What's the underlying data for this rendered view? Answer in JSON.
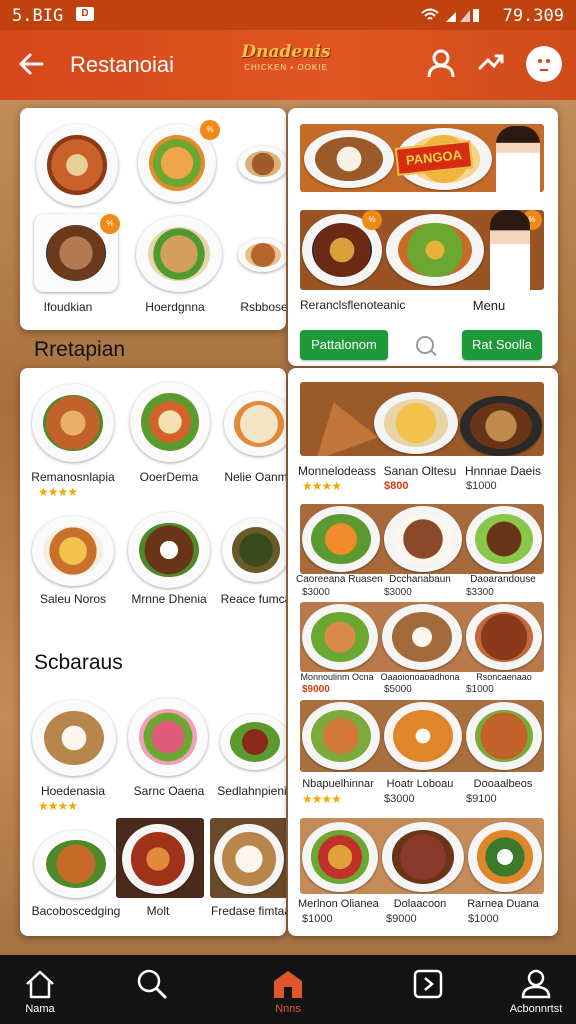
{
  "status_bar": {
    "left": "5.BIG",
    "sim": "D",
    "time": "79.309"
  },
  "app_bar": {
    "back_icon": "arrow-left-icon",
    "title": "Restanoiai",
    "logo_main": "Dnadenis",
    "logo_sub": "CHICKEN ▪ OOKIE"
  },
  "colors": {
    "accent": "#d6461a",
    "green": "#1f9a3b",
    "star": "#f2a900"
  },
  "top_left": {
    "labels": [
      "Ifoudkian",
      "Hoerdgnna",
      "Rsbbose"
    ]
  },
  "top_right": {
    "badge": "PANGOA",
    "caption": "Reranclsflenoteanic",
    "menu": "Menu",
    "left_button": "Pattalonom",
    "right_button": "Rat Soolla"
  },
  "sections": {
    "first": "Rretapian",
    "second": "Scbaraus"
  },
  "left_grid_1": [
    {
      "name": "Remanosnlapia",
      "stars": "★★★★"
    },
    {
      "name": "OoerDema",
      "stars": ""
    },
    {
      "name": "Nelie Oanm",
      "stars": ""
    },
    {
      "name": "Saleu Noros",
      "stars": ""
    },
    {
      "name": "Mrnne Dhenia",
      "stars": ""
    },
    {
      "name": "Reace fumca",
      "stars": ""
    }
  ],
  "left_grid_2": [
    {
      "name": "Hoedenasia",
      "stars": "★★★★"
    },
    {
      "name": "Sarnc Oaena",
      "stars": ""
    },
    {
      "name": "Sedlahnpienic",
      "stars": ""
    },
    {
      "name": "Bacoboscedging",
      "stars": ""
    },
    {
      "name": "Molt",
      "stars": ""
    },
    {
      "name": "Fredase fimtaa",
      "stars": ""
    }
  ],
  "right_rows": [
    {
      "items": [
        {
          "name": "Monnelodeass",
          "price": "",
          "stars": "★★★★",
          "red": false
        },
        {
          "name": "Sanan Oltesu",
          "price": "$800",
          "stars": "",
          "red": true
        },
        {
          "name": "Hnnnae Daeis",
          "price": "$1000",
          "stars": "",
          "red": false
        }
      ]
    },
    {
      "items": [
        {
          "name": "Caoreeana Ruasen",
          "price": "$3000",
          "stars": "",
          "red": false
        },
        {
          "name": "Dcchanabaun",
          "price": "$3000",
          "stars": "",
          "red": false
        },
        {
          "name": "Daoarandouse",
          "price": "$3300",
          "stars": "",
          "red": false
        }
      ]
    },
    {
      "items": [
        {
          "name": "Monnoulinm Ocna",
          "price": "$9000",
          "stars": "",
          "red": true
        },
        {
          "name": "Oaaoionoaoadhona",
          "price": "$5000",
          "stars": "",
          "red": false
        },
        {
          "name": "Rsoncaenaao",
          "price": "$1000",
          "stars": "",
          "red": false
        }
      ]
    },
    {
      "items": [
        {
          "name": "Nbapuelhinnar",
          "price": "",
          "stars": "★★★★",
          "red": false
        },
        {
          "name": "Hoatr Loboau",
          "price": "$3000",
          "stars": "",
          "red": false
        },
        {
          "name": "Dooaalbeos",
          "price": "$9100",
          "stars": "",
          "red": false
        }
      ]
    },
    {
      "items": [
        {
          "name": "Merlnon Olianea",
          "price": "$1000",
          "stars": "",
          "red": false
        },
        {
          "name": "Dolaacoon",
          "price": "$9000",
          "stars": "",
          "red": false
        },
        {
          "name": "Rarnea Duana",
          "price": "$1000",
          "stars": "",
          "red": false
        }
      ]
    }
  ],
  "bottom_nav": [
    {
      "label": "Nama",
      "icon": "home-icon"
    },
    {
      "label": "",
      "icon": "search-icon"
    },
    {
      "label": "Nnns",
      "icon": "store-icon"
    },
    {
      "label": "",
      "icon": "play-icon"
    },
    {
      "label": "Acbonnrtst",
      "icon": "profile-icon"
    }
  ]
}
